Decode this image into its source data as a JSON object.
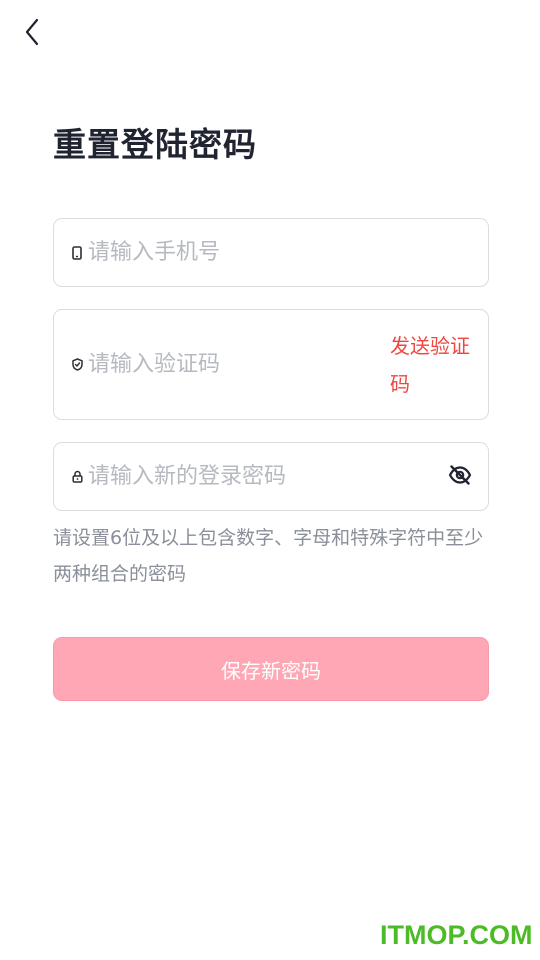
{
  "header": {
    "back_icon": "chevron-left-icon"
  },
  "page": {
    "title": "重置登陆密码"
  },
  "form": {
    "phone": {
      "icon": "phone-icon",
      "placeholder": "请输入手机号",
      "value": ""
    },
    "code": {
      "icon": "shield-check-icon",
      "placeholder": "请输入验证码",
      "value": "",
      "send_label": "发送验证码"
    },
    "password": {
      "icon": "lock-icon",
      "placeholder": "请输入新的登录密码",
      "value": "",
      "visibility_icon": "eye-off-icon"
    },
    "hint": "请设置6位及以上包含数字、字母和特殊字符中至少两种组合的密码",
    "save_label": "保存新密码"
  },
  "watermark": "ITMOP.COM",
  "colors": {
    "title": "#1f2430",
    "accent_red": "#f0463f",
    "button_bg": "#ffa7b5",
    "placeholder": "#b6b9c0",
    "hint": "#8a8f99",
    "watermark": "#4dbb27"
  }
}
